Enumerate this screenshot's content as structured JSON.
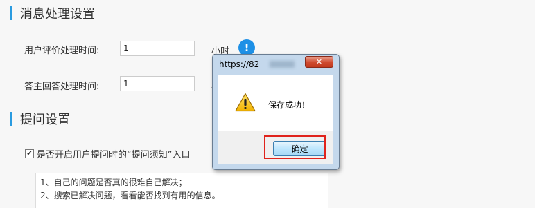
{
  "settings": {
    "message_section_title": "消息处理设置",
    "review_time_label": "用户评价处理时间:",
    "review_time_value": "1",
    "review_time_unit": "小时",
    "answer_time_label": "答主回答处理时间:",
    "answer_time_value": "1",
    "answer_time_unit": "小时",
    "question_section_title": "提问设置",
    "notice_checkbox_checked": true,
    "notice_checkbox_label": "是否开启用户提问时的“提问须知”入口",
    "notice_lines": [
      "1、自己的问题是否真的很难自己解决；",
      "2、搜索已解决问题，看看能否找到有用的信息。"
    ],
    "info_icon_glyph": "!"
  },
  "dialog": {
    "title": "https://82",
    "close_glyph": "✕",
    "message": "保存成功！",
    "ok_label": "确定",
    "icon": "warning-triangle-icon"
  },
  "colors": {
    "accent": "#2a9be0",
    "highlight": "#e0231c"
  }
}
